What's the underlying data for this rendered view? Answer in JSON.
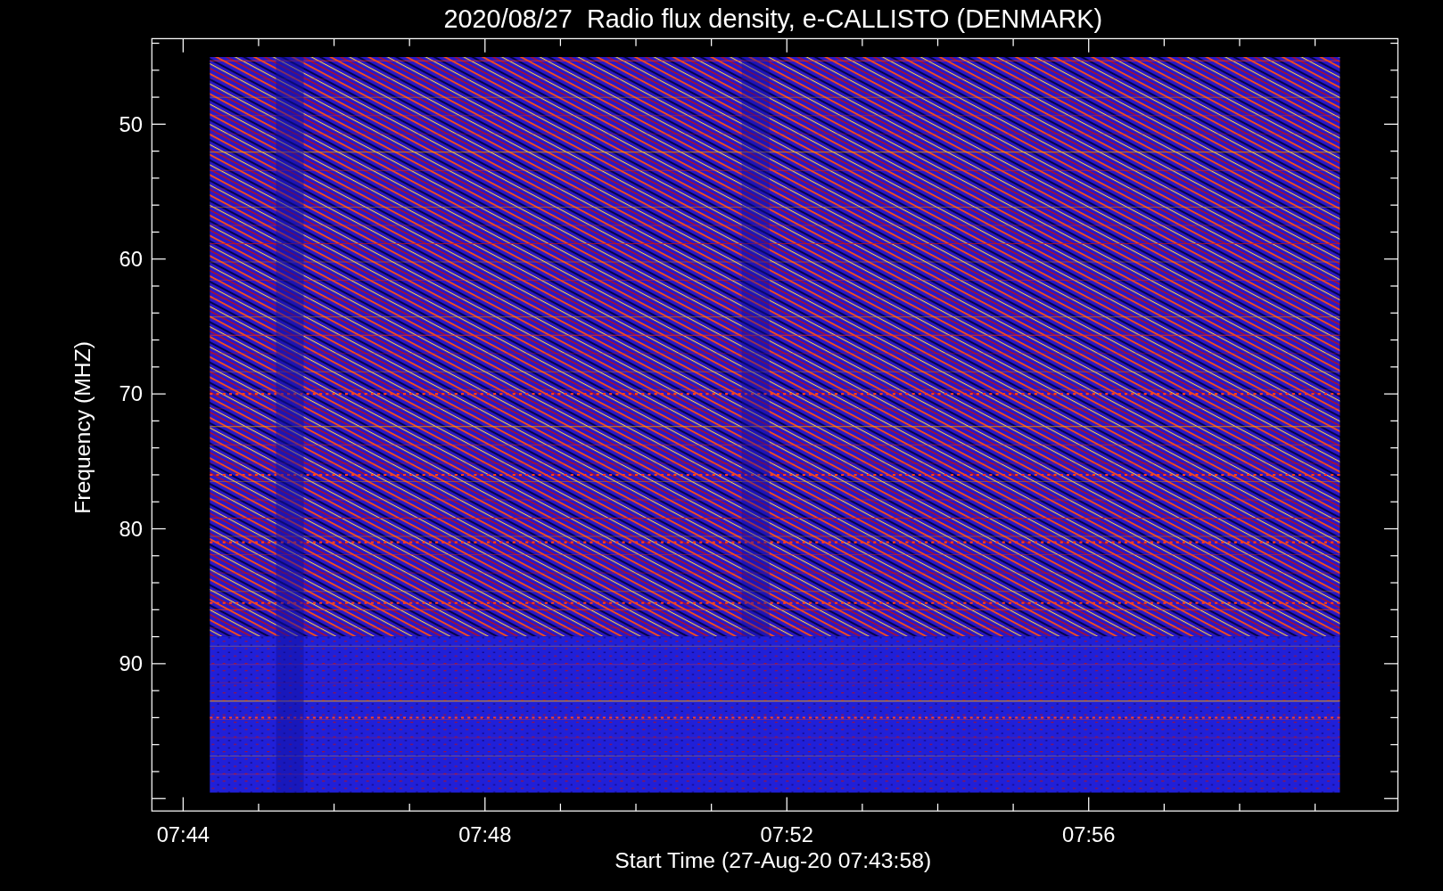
{
  "title": "2020/08/27  Radio flux density, e-CALLISTO (DENMARK)",
  "y_axis": {
    "label": "Frequency (MHZ)",
    "tick_labels": [
      "50",
      "60",
      "70",
      "80",
      "90"
    ]
  },
  "x_axis": {
    "label": "Start Time (27-Aug-20 07:43:58)",
    "tick_labels": [
      "07:44",
      "07:48",
      "07:52",
      "07:56"
    ]
  }
}
